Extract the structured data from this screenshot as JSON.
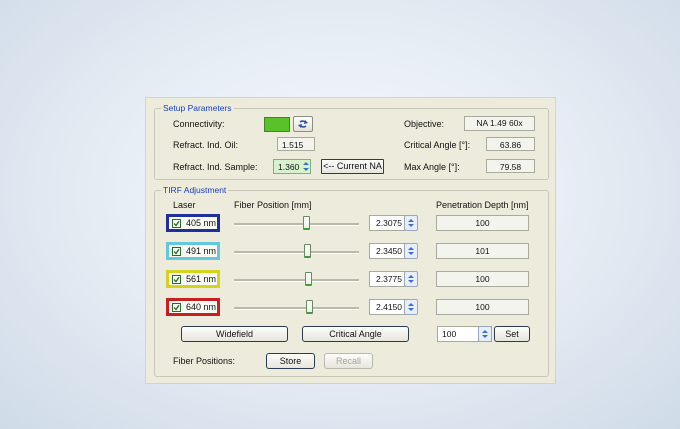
{
  "setup": {
    "title": "Setup Parameters",
    "connectivity_label": "Connectivity:",
    "connectivity_color": "#59c22a",
    "oil_label": "Refract. Ind. Oil:",
    "oil_value": "1.515",
    "sample_label": "Refract. Ind. Sample:",
    "sample_value": "1.360",
    "current_na_button": "<-- Current NA",
    "objective_label": "Objective:",
    "objective_value": "NA 1.49  60x",
    "critical_angle_label": "Critical Angle [°]:",
    "critical_angle_value": "63.86",
    "max_angle_label": "Max Angle [°]:",
    "max_angle_value": "79.58"
  },
  "tirf": {
    "title": "TIRF Adjustment",
    "laser_header": "Laser",
    "fiber_header": "Fiber Position [mm]",
    "depth_header": "Penetration Depth [nm]",
    "slider_range_mm": [
      0,
      4
    ],
    "lasers": [
      {
        "label": "405 nm",
        "color": "#20309a",
        "position": "2.3075",
        "position_mm": 2.3075,
        "depth": "100",
        "checked": true
      },
      {
        "label": "491 nm",
        "color": "#62c8dc",
        "position": "2.3450",
        "position_mm": 2.345,
        "depth": "101",
        "checked": true
      },
      {
        "label": "561 nm",
        "color": "#d4d420",
        "position": "2.3775",
        "position_mm": 2.3775,
        "depth": "100",
        "checked": true
      },
      {
        "label": "640 nm",
        "color": "#c82020",
        "position": "2.4150",
        "position_mm": 2.415,
        "depth": "100",
        "checked": true
      }
    ],
    "widefield_button": "Widefield",
    "critical_angle_button": "Critical Angle",
    "set_input_value": "100",
    "set_button": "Set",
    "fiber_positions_label": "Fiber Positions:",
    "store_button": "Store",
    "recall_button": "Recall"
  }
}
